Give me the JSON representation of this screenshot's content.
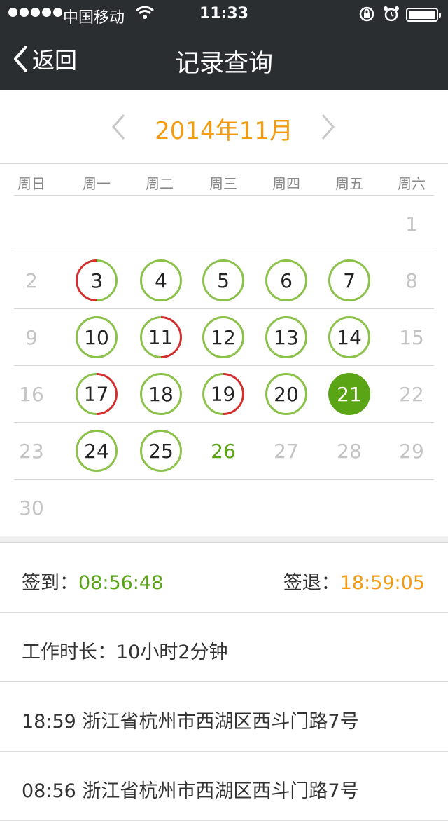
{
  "status_bar": {
    "carrier": "中国移动",
    "time": "11:33",
    "icons": [
      "signal-dots-icon",
      "wifi-icon",
      "rotation-lock-icon",
      "alarm-icon",
      "battery-icon"
    ]
  },
  "nav": {
    "back_label": "返回",
    "title": "记录查询"
  },
  "calendar": {
    "month_title": "2014年11月",
    "weekdays": [
      "周日",
      "周一",
      "周二",
      "周三",
      "周四",
      "周五",
      "周六"
    ],
    "days": {
      "d1": "1",
      "d2": "2",
      "d3": "3",
      "d4": "4",
      "d5": "5",
      "d6": "6",
      "d7": "7",
      "d8": "8",
      "d9": "9",
      "d10": "10",
      "d11": "11",
      "d12": "12",
      "d13": "13",
      "d14": "14",
      "d15": "15",
      "d16": "16",
      "d17": "17",
      "d18": "18",
      "d19": "19",
      "d20": "20",
      "d21": "21",
      "d22": "22",
      "d23": "23",
      "d24": "24",
      "d25": "25",
      "d26": "26",
      "d27": "27",
      "d28": "28",
      "d29": "29",
      "d30": "30"
    },
    "status_legend": {
      "ok_color": "#8cc24a",
      "warning_color": "#d32f2f",
      "selected_color": "#5aa515",
      "today_color": "#5aa515"
    },
    "selected_day": "21",
    "today": "26"
  },
  "record": {
    "sign_in_label": "签到：",
    "sign_in_time": "08:56:48",
    "sign_out_label": "签退：",
    "sign_out_time": "18:59:05",
    "work_duration": "工作时长：10小时2分钟",
    "logs": [
      "18:59 浙江省杭州市西湖区西斗门路7号",
      "08:56 浙江省杭州市西湖区西斗门路7号"
    ]
  }
}
